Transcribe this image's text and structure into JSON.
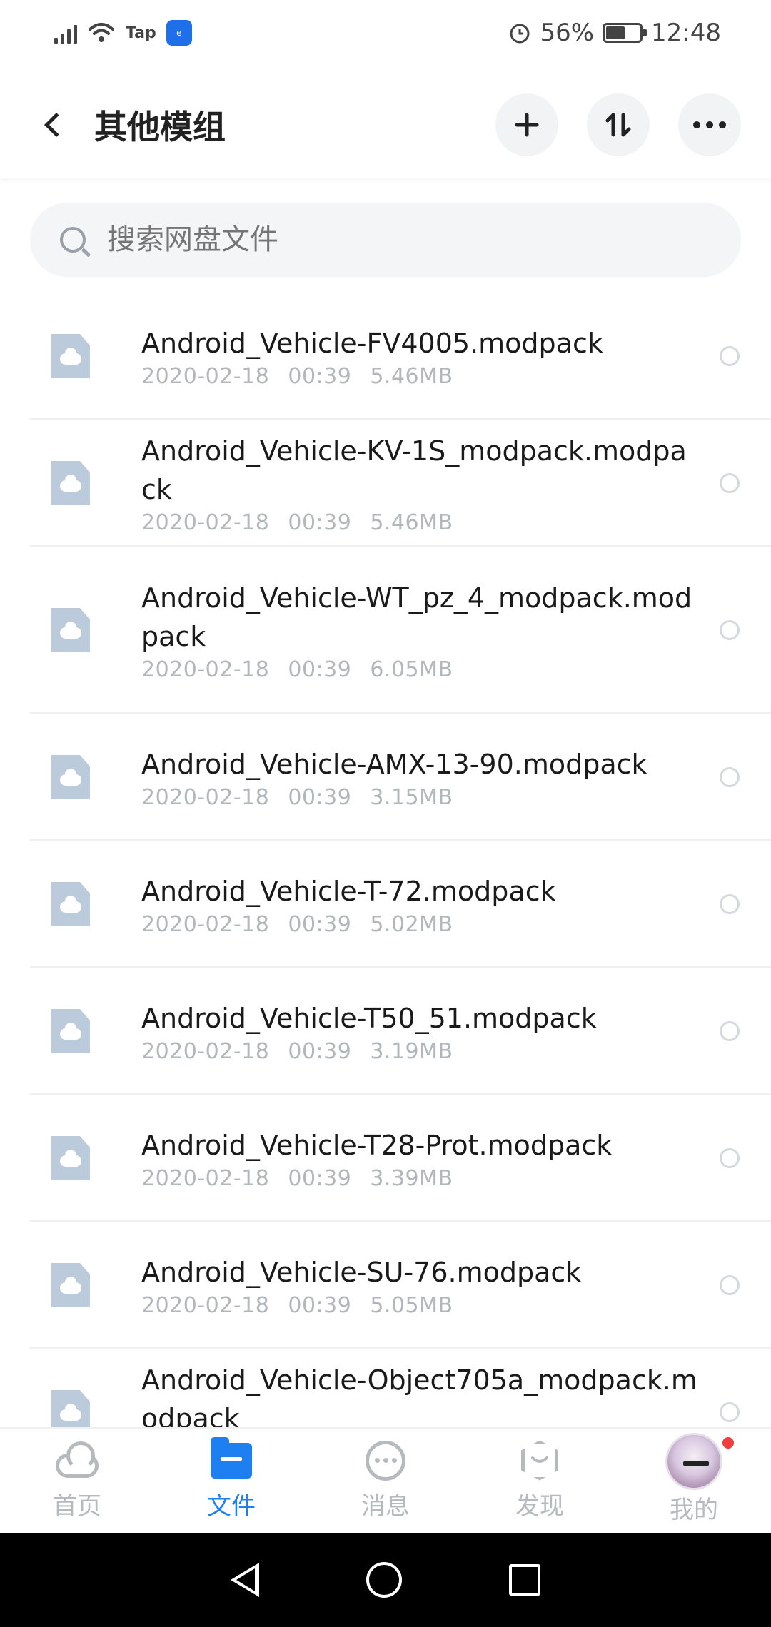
{
  "status_bar": {
    "carrier": "Tap",
    "app_badge": "e",
    "battery_text": "56%",
    "battery_level": 0.56,
    "time": "12:48"
  },
  "header": {
    "title": "其他模组",
    "icons": [
      "back-icon",
      "plus-icon",
      "sort-icon",
      "more-icon"
    ]
  },
  "search": {
    "placeholder": "搜索网盘文件"
  },
  "files": [
    {
      "name": "Android_Vehicle-FV4005.modpack",
      "date": "2020-02-18",
      "time": "00:39",
      "size": "5.46MB"
    },
    {
      "name": "Android_Vehicle-KV-1S_modpack.modpack",
      "date": "2020-02-18",
      "time": "00:39",
      "size": "5.46MB"
    },
    {
      "name": "Android_Vehicle-WT_pz_4_modpack.modpack",
      "date": "2020-02-18",
      "time": "00:39",
      "size": "6.05MB"
    },
    {
      "name": "Android_Vehicle-AMX-13-90.modpack",
      "date": "2020-02-18",
      "time": "00:39",
      "size": "3.15MB"
    },
    {
      "name": "Android_Vehicle-T-72.modpack",
      "date": "2020-02-18",
      "time": "00:39",
      "size": "5.02MB"
    },
    {
      "name": "Android_Vehicle-T50_51.modpack",
      "date": "2020-02-18",
      "time": "00:39",
      "size": "3.19MB"
    },
    {
      "name": "Android_Vehicle-T28-Prot.modpack",
      "date": "2020-02-18",
      "time": "00:39",
      "size": "3.39MB"
    },
    {
      "name": "Android_Vehicle-SU-76.modpack",
      "date": "2020-02-18",
      "time": "00:39",
      "size": "5.05MB"
    },
    {
      "name": "Android_Vehicle-Object705a_modpack.modpack",
      "date": "",
      "time": "",
      "size": ""
    }
  ],
  "bottom_nav": [
    {
      "label": "首页",
      "icon": "cloud-icon",
      "active": false
    },
    {
      "label": "文件",
      "icon": "folder-icon",
      "active": true
    },
    {
      "label": "消息",
      "icon": "message-icon",
      "active": false
    },
    {
      "label": "发现",
      "icon": "discover-icon",
      "active": false
    },
    {
      "label": "我的",
      "icon": "avatar",
      "active": false,
      "badge": true
    }
  ],
  "colors": {
    "accent": "#1e80f0",
    "file_icon": "#bccbdc",
    "badge": "#f23d3d"
  }
}
